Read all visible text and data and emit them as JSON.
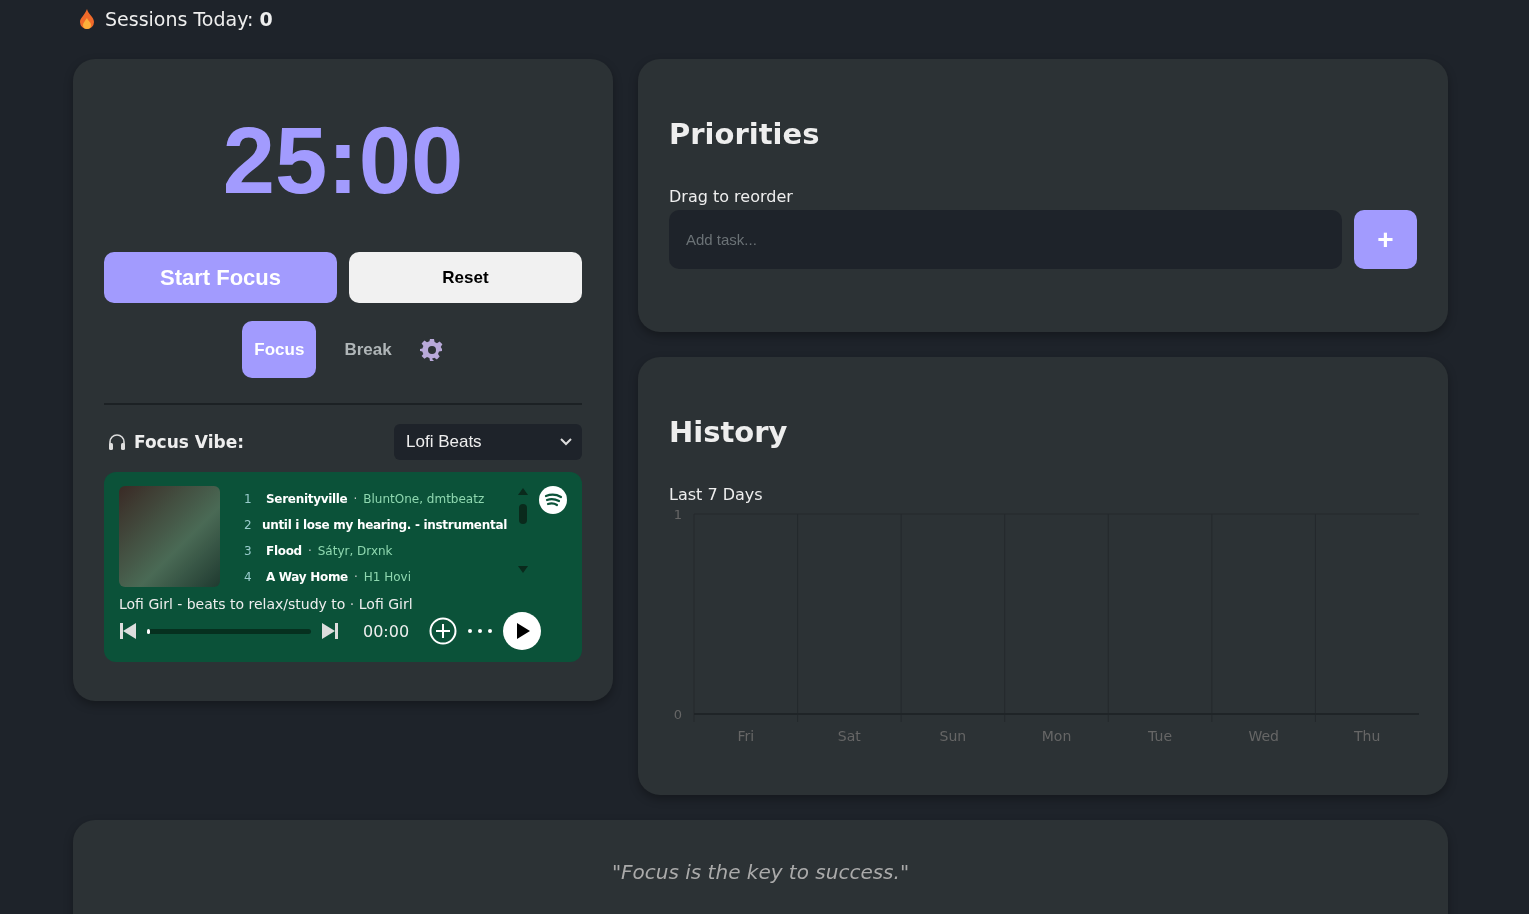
{
  "sessions": {
    "label": "Sessions Today:",
    "count": "0"
  },
  "timer": {
    "time": "25:00",
    "start_button": "Start Focus",
    "reset_button": "Reset",
    "modes": [
      {
        "label": "Focus",
        "selected": true
      },
      {
        "label": "Break",
        "selected": false
      }
    ]
  },
  "vibe": {
    "label": "Focus Vibe:",
    "select_value": "Lofi Beats"
  },
  "player": {
    "separator": "·",
    "tracks": [
      {
        "number": "1",
        "title": "Serenityville",
        "artist": "BluntOne, dmtbeatz"
      },
      {
        "number": "2",
        "title": "until i lose my hearing. - instrumental"
      },
      {
        "number": "3",
        "title": "Flood",
        "artist": "Sátyr, Drxnk"
      },
      {
        "number": "4",
        "title": "A Way Home",
        "artist": "H1 Hovi"
      }
    ],
    "playlist": "Lofi Girl - beats to relax/study to",
    "owner": "Lofi Girl",
    "time": "00:00",
    "level": 0
  },
  "priorities": {
    "title": "Priorities",
    "hint": "Drag to reorder",
    "placeholder": "Add task...",
    "add_button": "+"
  },
  "history": {
    "title": "History",
    "subtitle": "Last 7 Days",
    "chart_data": {
      "type": "bar",
      "categories": [
        "Fri",
        "Sat",
        "Sun",
        "Mon",
        "Tue",
        "Wed",
        "Thu"
      ],
      "values": [
        0,
        0,
        0,
        0,
        0,
        0,
        0
      ],
      "ylim": [
        0,
        1
      ],
      "yticks": [
        0,
        1
      ]
    }
  },
  "quote": "\"Focus is the key to success.\""
}
